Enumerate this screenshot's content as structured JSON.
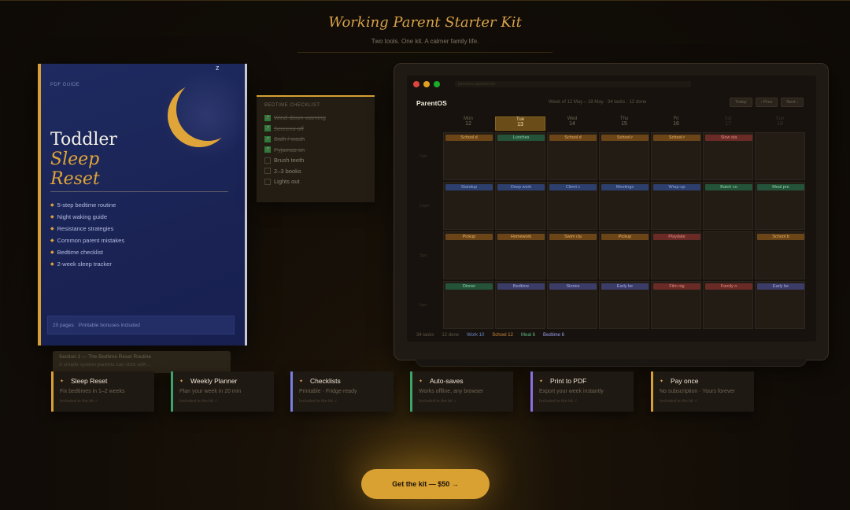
{
  "header": {
    "title": "Working Parent Starter Kit",
    "subtitle": "Two tools. One kit. A calmer family life."
  },
  "book": {
    "tag": "PDF GUIDE",
    "z": "z",
    "title_1": "Toddler",
    "title_2": "Sleep",
    "title_3": "Reset",
    "bullets": [
      "5-step bedtime routine",
      "Night waking guide",
      "Resistance strategies",
      "Common parent mistakes",
      "Bedtime checklist",
      "2-week sleep tracker"
    ],
    "footer_pages": "20 pages",
    "footer_bonus": "Printable bonuses included"
  },
  "checklist": {
    "title": "BEDTIME CHECKLIST",
    "items": [
      {
        "label": "Wind-down warning",
        "done": true
      },
      {
        "label": "Screens off",
        "done": true
      },
      {
        "label": "Bath / wash",
        "done": true
      },
      {
        "label": "Pyjamas on",
        "done": true
      },
      {
        "label": "Brush teeth",
        "done": false
      },
      {
        "label": "2–3 books",
        "done": false
      },
      {
        "label": "Lights out",
        "done": false
      }
    ],
    "check_glyph": "✓"
  },
  "note": {
    "line1": "Section 1 — The Bedtime Reset Routine",
    "line2": "A simple system parents can stick with..."
  },
  "planner": {
    "url": "parentos.app/planner",
    "app_name": "ParentOS",
    "week_info": "Week of 12 May – 18 May · 34 tasks · 12 done",
    "buttons": [
      "Today",
      "‹ Prev",
      "Next ›"
    ],
    "days": [
      {
        "name": "Mon",
        "num": "12"
      },
      {
        "name": "Tue",
        "num": "13"
      },
      {
        "name": "Wed",
        "num": "14"
      },
      {
        "name": "Thu",
        "num": "15"
      },
      {
        "name": "Fri",
        "num": "16"
      },
      {
        "name": "Sat",
        "num": "17"
      },
      {
        "name": "Sun",
        "num": "18"
      }
    ],
    "hours": [
      "7am",
      "12pm",
      "3pm",
      "6pm"
    ],
    "rows": [
      [
        "School d",
        "Lunches",
        "School d",
        "School r",
        "School r",
        "Slow sta",
        ""
      ],
      [
        "Standup",
        "Deep work",
        "Client c",
        "Meetings",
        "Wrap-up",
        "Batch co",
        "Meal pre"
      ],
      [
        "Pickup",
        "Homework",
        "Swim cla",
        "Pickup",
        "Playdate",
        "",
        "School b"
      ],
      [
        "Dinner",
        "Bedtime",
        "Stories",
        "Early be",
        "Film nig",
        "Family n",
        "Early be"
      ]
    ],
    "footer": [
      "34 tasks",
      "12 done",
      "Work 10",
      "School 12",
      "Meal 6",
      "Bedtime 6"
    ]
  },
  "features": [
    {
      "icon": "✦",
      "title": "Sleep Reset",
      "desc": "Fix bedtimes in 1–2 weeks",
      "note": "Included in the kit ✓",
      "accent": "#d8a034"
    },
    {
      "icon": "✦",
      "title": "Weekly Planner",
      "desc": "Plan your week in 20 min",
      "note": "Included in the kit ✓",
      "accent": "#3fa46a"
    },
    {
      "icon": "✦",
      "title": "Checklists",
      "desc": "Printable · Fridge-ready",
      "note": "Included in the kit ✓",
      "accent": "#7a7ee0"
    },
    {
      "icon": "✦",
      "title": "Auto-saves",
      "desc": "Works offline, any browser",
      "note": "Included in the kit ✓",
      "accent": "#3fa46a"
    },
    {
      "icon": "✦",
      "title": "Print to PDF",
      "desc": "Export your week instantly",
      "note": "Included in the kit ✓",
      "accent": "#8a6fe0"
    },
    {
      "icon": "✦",
      "title": "Pay once",
      "desc": "No subscription · Yours forever",
      "note": "Included in the kit ✓",
      "accent": "#d8a034"
    }
  ],
  "cta": {
    "label": "Get the kit — $50 →"
  },
  "colors": {
    "accent": "#d8a034",
    "background": "#120d07",
    "book_blue": "#1e2a60",
    "school": "#c07a2a",
    "work": "#4a6db8",
    "meal": "#3fa46a",
    "bedtime": "#7a7ee0",
    "family": "#b8453a"
  }
}
